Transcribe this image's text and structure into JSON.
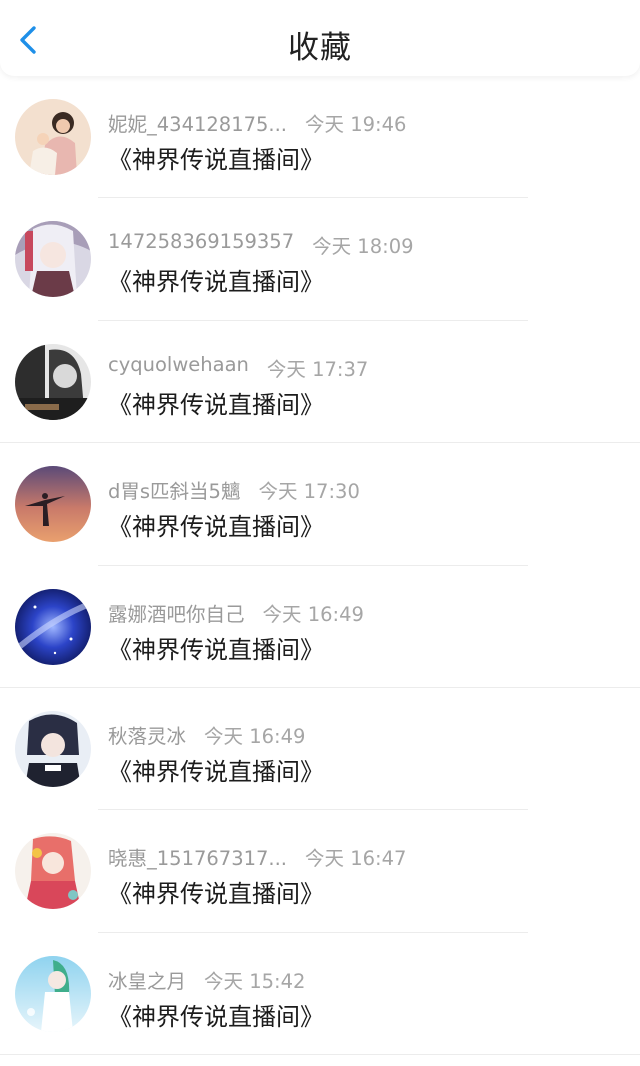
{
  "header": {
    "title": "收藏",
    "back_icon": "chevron-left-icon",
    "accent_color": "#1e8fe8"
  },
  "items": [
    {
      "name": "妮妮_434128175...",
      "time": "今天 19:46",
      "message": "《神界传说直播间》",
      "avatar": "girl-photo-avatar"
    },
    {
      "name": "147258369159357",
      "time": "今天 18:09",
      "message": "《神界传说直播间》",
      "avatar": "anime-girl-avatar"
    },
    {
      "name": "cyquolwehaan",
      "time": "今天 17:37",
      "message": "《神界传说直播间》",
      "avatar": "bw-portrait-avatar"
    },
    {
      "name": "d胃s匹斜当5魑",
      "time": "今天 17:30",
      "message": "《神界传说直播间》",
      "avatar": "sunset-silhouette-avatar"
    },
    {
      "name": "露娜酒吧你自己",
      "time": "今天 16:49",
      "message": "《神界传说直播间》",
      "avatar": "galaxy-avatar"
    },
    {
      "name": "秋落灵冰",
      "time": "今天 16:49",
      "message": "《神界传说直播间》",
      "avatar": "anime-boy-avatar"
    },
    {
      "name": "晓惠_151767317...",
      "time": "今天 16:47",
      "message": "《神界传说直播间》",
      "avatar": "anime-pink-avatar"
    },
    {
      "name": "冰皇之月",
      "time": "今天 15:42",
      "message": "《神界传说直播间》",
      "avatar": "anime-green-hair-avatar"
    }
  ]
}
